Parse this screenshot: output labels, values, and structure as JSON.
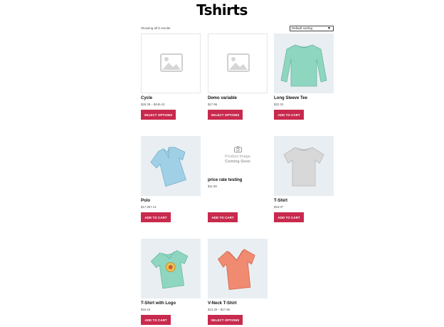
{
  "page": {
    "title": "Tshirts"
  },
  "toolbar": {
    "result_count": "Showing all 8 results",
    "orderby_selected": "Default sorting"
  },
  "products": [
    {
      "name": "Cycle",
      "price": "$26.36 – $446.43",
      "button": "Select options",
      "image": "placeholder-icon"
    },
    {
      "name": "Demo variable",
      "price": "$17.96",
      "button": "Select options",
      "image": "placeholder-icon"
    },
    {
      "name": "Long Sleeve Tee",
      "price": "$22.32",
      "button": "Add to cart",
      "image": "long-sleeve-tee-image"
    },
    {
      "name": "Polo",
      "price": "$17,857.14",
      "button": "Add to cart",
      "image": "polo-shirt-image"
    },
    {
      "name": "price rate testing",
      "price": "$11.98",
      "button": "Add to cart",
      "image": "coming-soon-image",
      "image_text_1": "Product Image",
      "image_text_2": "Coming Soon"
    },
    {
      "name": "T-Shirt",
      "price": "$16.07",
      "button": "Add to cart",
      "image": "tshirt-grey-image"
    },
    {
      "name": "T-Shirt with Logo",
      "price": "$16.16",
      "button": "Add to cart",
      "image": "tshirt-with-logo-image"
    },
    {
      "name": "V-Neck T-Shirt",
      "price": "$13.39 – $17.86",
      "button": "Select options",
      "image": "vneck-tshirt-image"
    }
  ],
  "colors": {
    "button": "#c8294d",
    "image_bg": "#e9eef2",
    "mint": "#8fd6c0",
    "light_blue": "#9fd0e6",
    "grey_shirt": "#d8d8d8",
    "coral": "#f08a70"
  }
}
